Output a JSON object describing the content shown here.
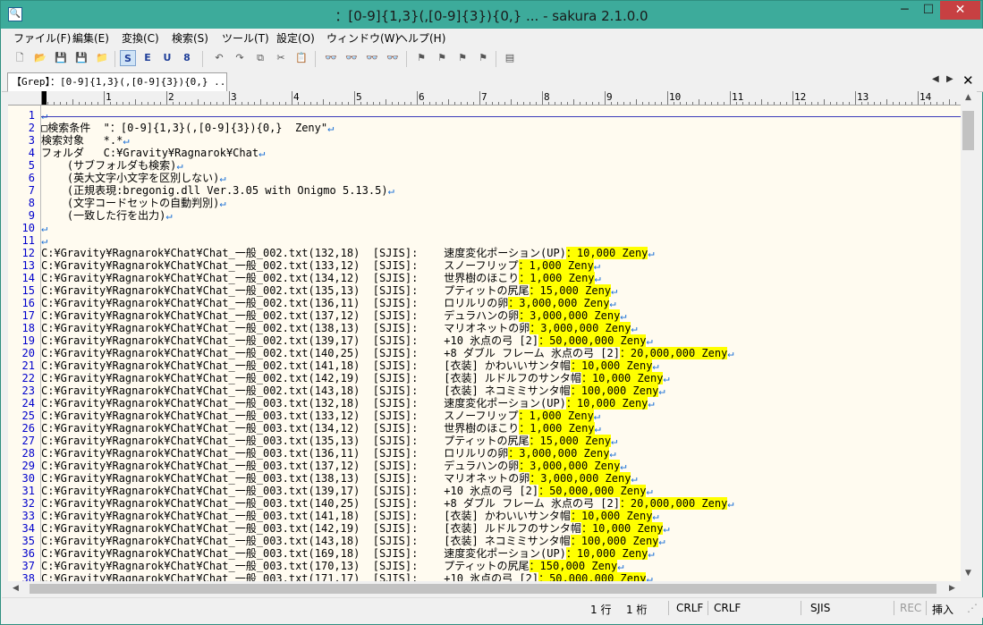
{
  "window": {
    "title": "：[0-9]{1,3}(,[0-9]{3}){0,}  ... - sakura 2.1.0.0",
    "app_icon_glyph": "🔍",
    "minimize": "─",
    "maximize": "☐",
    "close": "✕"
  },
  "menu": [
    "ファイル(F)",
    "編集(E)",
    "変換(C)",
    "検索(S)",
    "ツール(T)",
    "設定(O)",
    "ウィンドウ(W)",
    "ヘルプ(H)"
  ],
  "toolbar": {
    "new": "🗋",
    "open": "📂",
    "save": "💾",
    "save_all": "💾",
    "favorite": "📁",
    "s": "S",
    "e": "E",
    "u": "U",
    "8": "8",
    "undo": "↶",
    "redo": "↷",
    "copy": "⧉",
    "cut": "✂",
    "paste": "📋",
    "find": "👓",
    "find_prev": "👓",
    "find_next": "👓",
    "grep": "👓",
    "jump": "⚑",
    "bm1": "⚑",
    "bm2": "⚑",
    "bm3": "⚑",
    "outline": "▤"
  },
  "tab": {
    "label": "【Grep】：[0-9]{1,3}(,[0-9]{3}){0,} ...",
    "scroll_left": "◀",
    "scroll_right": "▶",
    "close": "✕"
  },
  "ruler": [
    "0",
    "1",
    "2",
    "3",
    "4",
    "5",
    "6",
    "7",
    "8",
    "9",
    "10",
    "11",
    "12",
    "13",
    "14"
  ],
  "eol_glyph": "↵",
  "lines": [
    {
      "n": "1",
      "a": "",
      "h": "",
      "z": ""
    },
    {
      "n": "2",
      "a": "□検索条件  \"：[0-9]{1,3}(,[0-9]{3}){0,}  Zeny\"",
      "h": "",
      "z": ""
    },
    {
      "n": "3",
      "a": "検索対象   *.*",
      "h": "",
      "z": ""
    },
    {
      "n": "4",
      "a": "フォルダ   C:¥Gravity¥Ragnarok¥Chat",
      "h": "",
      "z": ""
    },
    {
      "n": "5",
      "a": "    (サブフォルダも検索)",
      "h": "",
      "z": ""
    },
    {
      "n": "6",
      "a": "    (英大文字小文字を区別しない)",
      "h": "",
      "z": ""
    },
    {
      "n": "7",
      "a": "    (正規表現:bregonig.dll Ver.3.05 with Onigmo 5.13.5)",
      "h": "",
      "z": ""
    },
    {
      "n": "8",
      "a": "    (文字コードセットの自動判別)",
      "h": "",
      "z": ""
    },
    {
      "n": "9",
      "a": "    (一致した行を出力)",
      "h": "",
      "z": ""
    },
    {
      "n": "10",
      "a": "",
      "h": "",
      "z": ""
    },
    {
      "n": "11",
      "a": "",
      "h": "",
      "z": ""
    },
    {
      "n": "12",
      "a": "C:¥Gravity¥Ragnarok¥Chat¥Chat_一般_002.txt(132,18)  [SJIS]:    速度変化ポーション(UP)",
      "h": "：10,000",
      "z": " Zeny"
    },
    {
      "n": "13",
      "a": "C:¥Gravity¥Ragnarok¥Chat¥Chat_一般_002.txt(133,12)  [SJIS]:    スノーフリップ",
      "h": "：1,000",
      "z": " Zeny"
    },
    {
      "n": "14",
      "a": "C:¥Gravity¥Ragnarok¥Chat¥Chat_一般_002.txt(134,12)  [SJIS]:    世界樹のほこり",
      "h": "：1,000",
      "z": " Zeny"
    },
    {
      "n": "15",
      "a": "C:¥Gravity¥Ragnarok¥Chat¥Chat_一般_002.txt(135,13)  [SJIS]:    プティットの尻尾",
      "h": "：15,000",
      "z": " Zeny"
    },
    {
      "n": "16",
      "a": "C:¥Gravity¥Ragnarok¥Chat¥Chat_一般_002.txt(136,11)  [SJIS]:    ロリルリの卵",
      "h": "：3,000,000",
      "z": " Zeny"
    },
    {
      "n": "17",
      "a": "C:¥Gravity¥Ragnarok¥Chat¥Chat_一般_002.txt(137,12)  [SJIS]:    デュラハンの卵",
      "h": "：3,000,000",
      "z": " Zeny"
    },
    {
      "n": "18",
      "a": "C:¥Gravity¥Ragnarok¥Chat¥Chat_一般_002.txt(138,13)  [SJIS]:    マリオネットの卵",
      "h": "：3,000,000",
      "z": " Zeny"
    },
    {
      "n": "19",
      "a": "C:¥Gravity¥Ragnarok¥Chat¥Chat_一般_002.txt(139,17)  [SJIS]:    +10 氷点の弓 [2]",
      "h": "：50,000,000",
      "z": " Zeny"
    },
    {
      "n": "20",
      "a": "C:¥Gravity¥Ragnarok¥Chat¥Chat_一般_002.txt(140,25)  [SJIS]:    +8 ダブル フレーム 氷点の弓 [2]",
      "h": "：20,000,000",
      "z": " Zeny"
    },
    {
      "n": "21",
      "a": "C:¥Gravity¥Ragnarok¥Chat¥Chat_一般_002.txt(141,18)  [SJIS]:    [衣装] かわいいサンタ帽",
      "h": "：10,000",
      "z": " Zeny"
    },
    {
      "n": "22",
      "a": "C:¥Gravity¥Ragnarok¥Chat¥Chat_一般_002.txt(142,19)  [SJIS]:    [衣装] ルドルフのサンタ帽",
      "h": "：10,000",
      "z": " Zeny"
    },
    {
      "n": "23",
      "a": "C:¥Gravity¥Ragnarok¥Chat¥Chat_一般_002.txt(143,18)  [SJIS]:    [衣装] ネコミミサンタ帽",
      "h": "：100,000",
      "z": " Zeny"
    },
    {
      "n": "24",
      "a": "C:¥Gravity¥Ragnarok¥Chat¥Chat_一般_003.txt(132,18)  [SJIS]:    速度変化ポーション(UP)",
      "h": "：10,000",
      "z": " Zeny"
    },
    {
      "n": "25",
      "a": "C:¥Gravity¥Ragnarok¥Chat¥Chat_一般_003.txt(133,12)  [SJIS]:    スノーフリップ",
      "h": "：1,000",
      "z": " Zeny"
    },
    {
      "n": "26",
      "a": "C:¥Gravity¥Ragnarok¥Chat¥Chat_一般_003.txt(134,12)  [SJIS]:    世界樹のほこり",
      "h": "：1,000",
      "z": " Zeny"
    },
    {
      "n": "27",
      "a": "C:¥Gravity¥Ragnarok¥Chat¥Chat_一般_003.txt(135,13)  [SJIS]:    プティットの尻尾",
      "h": "：15,000",
      "z": " Zeny"
    },
    {
      "n": "28",
      "a": "C:¥Gravity¥Ragnarok¥Chat¥Chat_一般_003.txt(136,11)  [SJIS]:    ロリルリの卵",
      "h": "：3,000,000",
      "z": " Zeny"
    },
    {
      "n": "29",
      "a": "C:¥Gravity¥Ragnarok¥Chat¥Chat_一般_003.txt(137,12)  [SJIS]:    デュラハンの卵",
      "h": "：3,000,000",
      "z": " Zeny"
    },
    {
      "n": "30",
      "a": "C:¥Gravity¥Ragnarok¥Chat¥Chat_一般_003.txt(138,13)  [SJIS]:    マリオネットの卵",
      "h": "：3,000,000",
      "z": " Zeny"
    },
    {
      "n": "31",
      "a": "C:¥Gravity¥Ragnarok¥Chat¥Chat_一般_003.txt(139,17)  [SJIS]:    +10 氷点の弓 [2]",
      "h": "：50,000,000",
      "z": " Zeny"
    },
    {
      "n": "32",
      "a": "C:¥Gravity¥Ragnarok¥Chat¥Chat_一般_003.txt(140,25)  [SJIS]:    +8 ダブル フレーム 氷点の弓 [2]",
      "h": "：20,000,000",
      "z": " Zeny"
    },
    {
      "n": "33",
      "a": "C:¥Gravity¥Ragnarok¥Chat¥Chat_一般_003.txt(141,18)  [SJIS]:    [衣装] かわいいサンタ帽",
      "h": "：10,000",
      "z": " Zeny"
    },
    {
      "n": "34",
      "a": "C:¥Gravity¥Ragnarok¥Chat¥Chat_一般_003.txt(142,19)  [SJIS]:    [衣装] ルドルフのサンタ帽",
      "h": "：10,000",
      "z": " Zeny"
    },
    {
      "n": "35",
      "a": "C:¥Gravity¥Ragnarok¥Chat¥Chat_一般_003.txt(143,18)  [SJIS]:    [衣装] ネコミミサンタ帽",
      "h": "：100,000",
      "z": " Zeny"
    },
    {
      "n": "36",
      "a": "C:¥Gravity¥Ragnarok¥Chat¥Chat_一般_003.txt(169,18)  [SJIS]:    速度変化ポーション(UP)",
      "h": "：10,000",
      "z": " Zeny"
    },
    {
      "n": "37",
      "a": "C:¥Gravity¥Ragnarok¥Chat¥Chat_一般_003.txt(170,13)  [SJIS]:    プティットの尻尾",
      "h": "：150,000",
      "z": " Zeny"
    },
    {
      "n": "38",
      "a": "C:¥Gravity¥Ragnarok¥Chat¥Chat_一般_003.txt(171,17)  [SJIS]:    +10 氷点の弓 [2]",
      "h": "：50,000,000",
      "z": " Zeny"
    }
  ],
  "status": {
    "line": "1 行",
    "col": "1 桁",
    "eol1": "CRLF",
    "eol2": "CRLF",
    "encoding": "SJIS",
    "rec": "REC",
    "mode": "挿入"
  },
  "colors": {
    "titlebar": "#3dab9b",
    "editor_bg": "#fffbf0",
    "line_number": "#0000cc",
    "highlight": "#ffff00",
    "eol_mark": "#1a6fd6"
  }
}
